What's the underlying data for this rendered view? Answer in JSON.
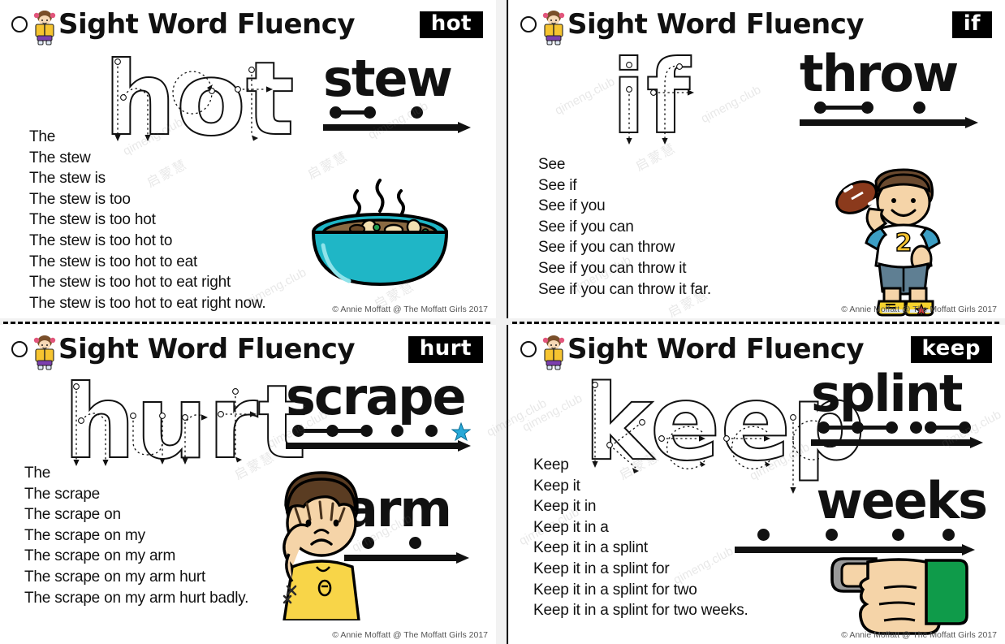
{
  "document": {
    "title": "Sight Word Fluency",
    "copyright": "© Annie Moffatt @ The Moffatt Girls 2017",
    "watermark_latin": "qimeng.club",
    "watermark_cjk": "启蒙慧",
    "colors": {
      "chip_bg": "#000000",
      "chip_text": "#ffffff",
      "ink": "#111111",
      "star": "#27a9d8",
      "bowl": "#1fb6c6",
      "stew": "#8a6a42",
      "jersey": "#ffffff",
      "shorts": "#5f7f93",
      "shoe": "#f6d32d",
      "shirt_yellow": "#f8d548",
      "hair_brown": "#6b4a2f",
      "skin": "#f5d4a8",
      "splint_gray": "#9a9a9a",
      "sleeve_green": "#0f9b4a"
    }
  },
  "panels": [
    {
      "id": "panel-hot",
      "header_title": "Sight Word Fluency",
      "word_chip": "hot",
      "trace_word": "hot",
      "icon": "girl-reading-icon",
      "ladder": [
        "The",
        "The stew",
        "The stew is",
        "The stew is too",
        "The stew is too hot",
        "The stew is too hot to",
        "The stew is too hot to eat",
        "The stew is too hot to eat right",
        "The stew is too hot to eat right now."
      ],
      "phonics": [
        {
          "word": "stew",
          "dot_count": 3,
          "links": [
            [
              0,
              1
            ]
          ],
          "star": false
        }
      ],
      "illustration": "bowl-of-stew-illustration",
      "copyright": "© Annie Moffatt @ The Moffatt Girls 2017"
    },
    {
      "id": "panel-if",
      "header_title": "Sight Word Fluency",
      "word_chip": "if",
      "trace_word": "if",
      "icon": "girl-reading-icon",
      "ladder": [
        "See",
        "See if",
        "See if you",
        "See if you can",
        "See if you can throw",
        "See if you can throw it",
        "See if you can throw it far."
      ],
      "phonics": [
        {
          "word": "throw",
          "dot_count": 3,
          "links": [
            [
              0,
              1
            ]
          ],
          "star": false
        }
      ],
      "illustration": "boy-throwing-football-illustration",
      "copyright": "© Annie Moffatt @ The Moffatt Girls 2017"
    },
    {
      "id": "panel-hurt",
      "header_title": "Sight Word Fluency",
      "word_chip": "hurt",
      "trace_word": "hurt",
      "icon": "girl-reading-icon",
      "ladder": [
        "The",
        "The scrape",
        "The scrape on",
        "The scrape on my",
        "The scrape on my arm",
        "The scrape on my arm hurt",
        "The scrape on my arm hurt badly."
      ],
      "phonics": [
        {
          "word": "scrape",
          "dot_count": 5,
          "links": [
            [
              0,
              1
            ],
            [
              1,
              2
            ]
          ],
          "star": true
        },
        {
          "word": "arm",
          "dot_count": 2,
          "links": [],
          "star": false
        }
      ],
      "illustration": "boy-with-scraped-arm-illustration",
      "copyright": "© Annie Moffatt @ The Moffatt Girls 2017"
    },
    {
      "id": "panel-keep",
      "header_title": "Sight Word Fluency",
      "word_chip": "keep",
      "trace_word": "keep",
      "icon": "girl-reading-icon",
      "ladder": [
        "Keep",
        "Keep it",
        "Keep it in",
        "Keep it in a",
        "Keep it in a splint",
        "Keep it in a splint for",
        "Keep it in a splint for two",
        "Keep it in a splint for two weeks."
      ],
      "phonics": [
        {
          "word": "splint",
          "dot_count": 6,
          "links": [
            [
              0,
              1
            ],
            [
              1,
              2
            ],
            [
              4,
              5
            ]
          ],
          "star": false
        },
        {
          "word": "weeks",
          "dot_count": 4,
          "links": [],
          "star": false
        }
      ],
      "illustration": "hand-with-finger-splint-illustration",
      "copyright": "© Annie Moffatt @ The Moffatt Girls 2017"
    }
  ]
}
